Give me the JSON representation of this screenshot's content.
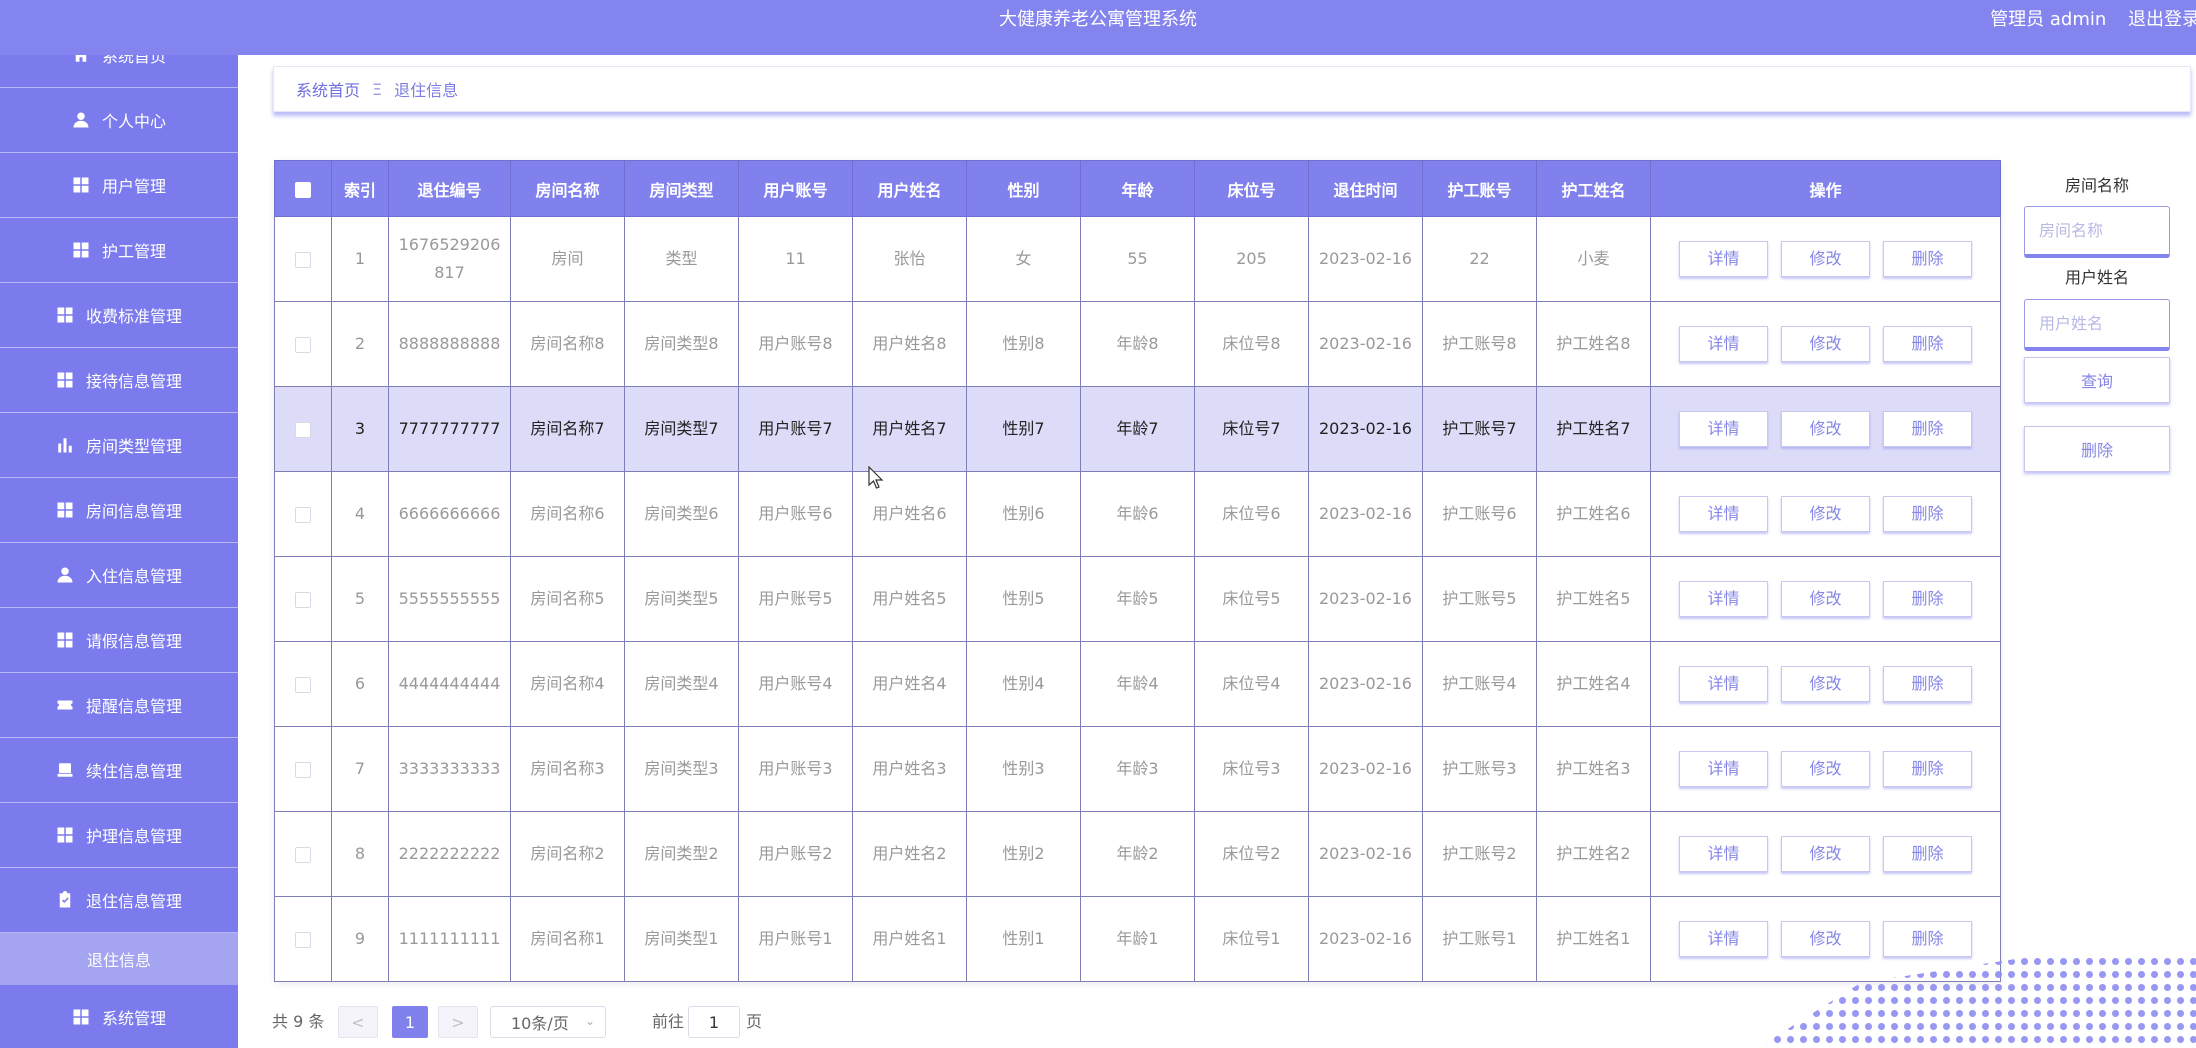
{
  "header": {
    "title": "大健康养老公寓管理系统",
    "user_label": "管理员 admin",
    "logout_label": "退出登录"
  },
  "sidebar": {
    "items": [
      {
        "label": "系统首页",
        "icon": "home-icon"
      },
      {
        "label": "个人中心",
        "icon": "user-icon"
      },
      {
        "label": "用户管理",
        "icon": "grid-icon"
      },
      {
        "label": "护工管理",
        "icon": "grid-icon"
      },
      {
        "label": "收费标准管理",
        "icon": "grid-icon"
      },
      {
        "label": "接待信息管理",
        "icon": "grid-icon"
      },
      {
        "label": "房间类型管理",
        "icon": "bar-chart-icon"
      },
      {
        "label": "房间信息管理",
        "icon": "grid-icon"
      },
      {
        "label": "入住信息管理",
        "icon": "user-icon"
      },
      {
        "label": "请假信息管理",
        "icon": "grid-icon"
      },
      {
        "label": "提醒信息管理",
        "icon": "ticket-icon"
      },
      {
        "label": "续住信息管理",
        "icon": "printer-icon"
      },
      {
        "label": "护理信息管理",
        "icon": "grid-icon"
      },
      {
        "label": "退住信息管理",
        "icon": "clipboard-check-icon"
      }
    ],
    "subitem": "退住信息",
    "last_item": {
      "label": "系统管理",
      "icon": "grid-icon"
    }
  },
  "breadcrumb": {
    "home": "系统首页",
    "separator": "Ξ",
    "current": "退住信息"
  },
  "table": {
    "columns": [
      "索引",
      "退住编号",
      "房间名称",
      "房间类型",
      "用户账号",
      "用户姓名",
      "性别",
      "年龄",
      "床位号",
      "退住时间",
      "护工账号",
      "护工姓名",
      "操作"
    ],
    "actions": {
      "detail": "详情",
      "edit": "修改",
      "delete": "删除"
    },
    "rows": [
      [
        "1",
        "1676529206817",
        "房间",
        "类型",
        "11",
        "张怡",
        "女",
        "55",
        "205",
        "2023-02-16",
        "22",
        "小麦"
      ],
      [
        "2",
        "8888888888",
        "房间名称8",
        "房间类型8",
        "用户账号8",
        "用户姓名8",
        "性别8",
        "年龄8",
        "床位号8",
        "2023-02-16",
        "护工账号8",
        "护工姓名8"
      ],
      [
        "3",
        "7777777777",
        "房间名称7",
        "房间类型7",
        "用户账号7",
        "用户姓名7",
        "性别7",
        "年龄7",
        "床位号7",
        "2023-02-16",
        "护工账号7",
        "护工姓名7"
      ],
      [
        "4",
        "6666666666",
        "房间名称6",
        "房间类型6",
        "用户账号6",
        "用户姓名6",
        "性别6",
        "年龄6",
        "床位号6",
        "2023-02-16",
        "护工账号6",
        "护工姓名6"
      ],
      [
        "5",
        "5555555555",
        "房间名称5",
        "房间类型5",
        "用户账号5",
        "用户姓名5",
        "性别5",
        "年龄5",
        "床位号5",
        "2023-02-16",
        "护工账号5",
        "护工姓名5"
      ],
      [
        "6",
        "4444444444",
        "房间名称4",
        "房间类型4",
        "用户账号4",
        "用户姓名4",
        "性别4",
        "年龄4",
        "床位号4",
        "2023-02-16",
        "护工账号4",
        "护工姓名4"
      ],
      [
        "7",
        "3333333333",
        "房间名称3",
        "房间类型3",
        "用户账号3",
        "用户姓名3",
        "性别3",
        "年龄3",
        "床位号3",
        "2023-02-16",
        "护工账号3",
        "护工姓名3"
      ],
      [
        "8",
        "2222222222",
        "房间名称2",
        "房间类型2",
        "用户账号2",
        "用户姓名2",
        "性别2",
        "年龄2",
        "床位号2",
        "2023-02-16",
        "护工账号2",
        "护工姓名2"
      ],
      [
        "9",
        "1111111111",
        "房间名称1",
        "房间类型1",
        "用户账号1",
        "用户姓名1",
        "性别1",
        "年龄1",
        "床位号1",
        "2023-02-16",
        "护工账号1",
        "护工姓名1"
      ]
    ],
    "highlighted_row": 2
  },
  "search": {
    "room_label": "房间名称",
    "room_placeholder": "房间名称",
    "user_label": "用户姓名",
    "user_placeholder": "用户姓名",
    "query_button": "查询",
    "delete_button": "删除"
  },
  "pagination": {
    "total": "共 9 条",
    "prev": "<",
    "current_page": "1",
    "next": ">",
    "page_size": "10条/页",
    "goto_prefix": "前往",
    "goto_value": "1",
    "goto_suffix": "页"
  },
  "colors": {
    "primary": "#8181ee",
    "header": "#8484ef",
    "highlight_row": "#dcdcf8"
  }
}
